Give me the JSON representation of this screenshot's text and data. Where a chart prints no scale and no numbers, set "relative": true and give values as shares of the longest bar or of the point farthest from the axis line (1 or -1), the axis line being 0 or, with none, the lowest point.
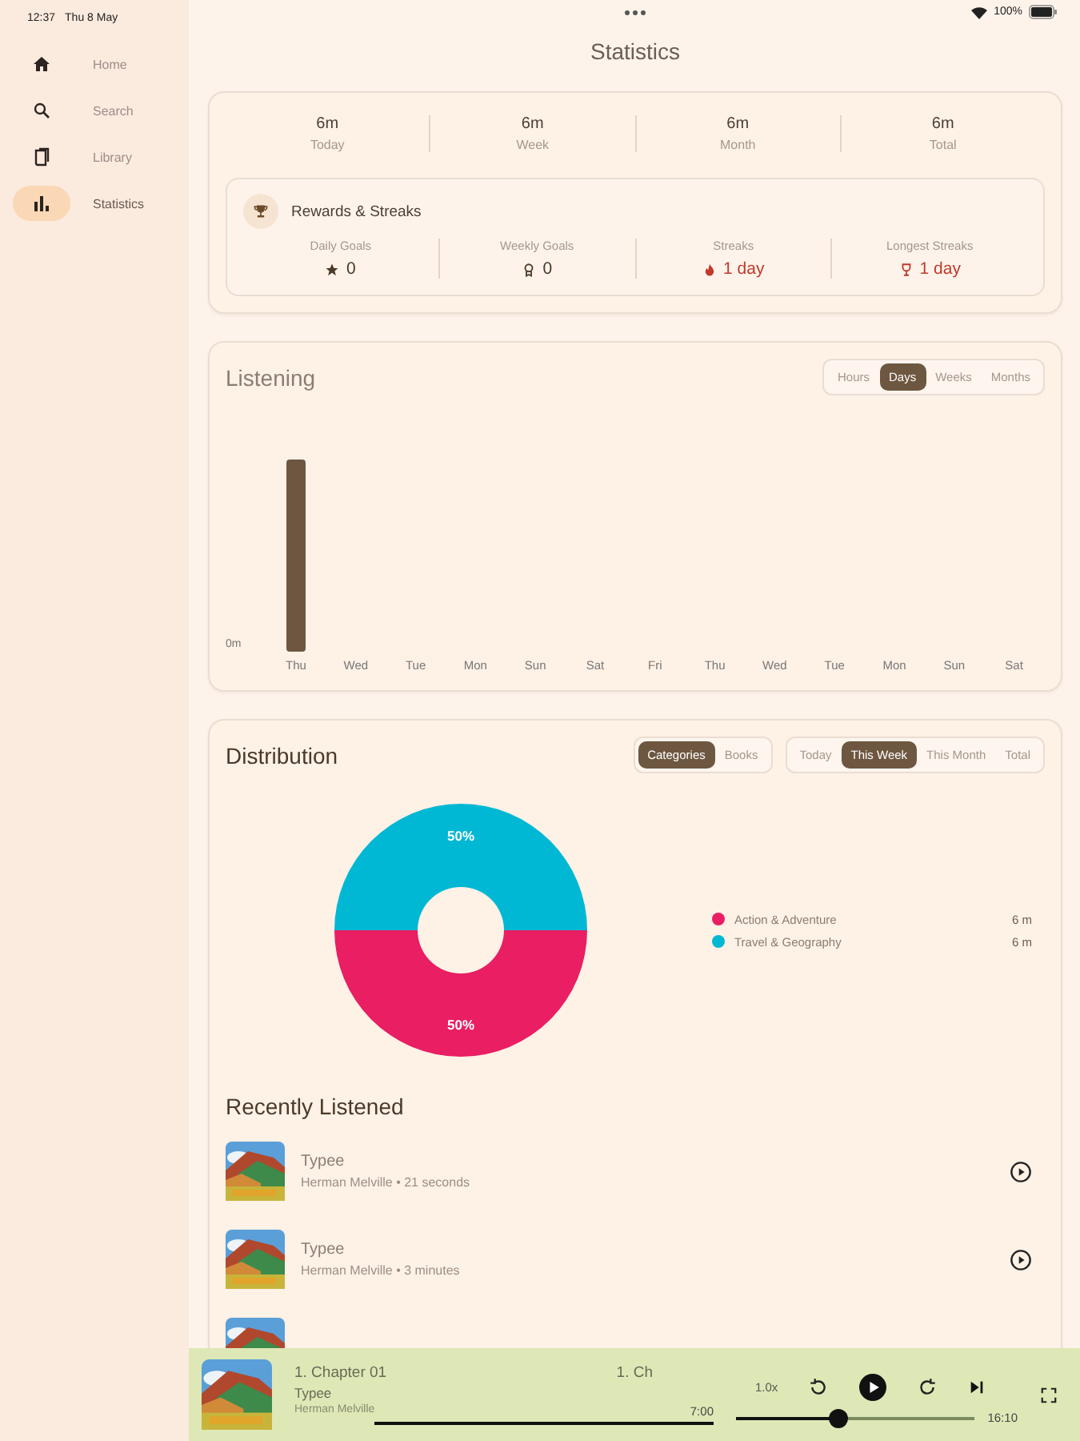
{
  "status_bar": {
    "time": "12:37",
    "date": "Thu 8 May",
    "battery": "100%"
  },
  "sidebar": {
    "items": [
      {
        "label": "Home",
        "selected": false
      },
      {
        "label": "Search",
        "selected": false
      },
      {
        "label": "Library",
        "selected": false
      },
      {
        "label": "Statistics",
        "selected": true
      }
    ]
  },
  "title": "Statistics",
  "summary": [
    {
      "value": "6m",
      "label": "Today"
    },
    {
      "value": "6m",
      "label": "Week"
    },
    {
      "value": "6m",
      "label": "Month"
    },
    {
      "value": "6m",
      "label": "Total"
    }
  ],
  "rewards": {
    "title": "Rewards & Streaks",
    "items": [
      {
        "label": "Daily Goals",
        "value": "0",
        "highlight": false
      },
      {
        "label": "Weekly Goals",
        "value": "0",
        "highlight": false
      },
      {
        "label": "Streaks",
        "value": "1 day",
        "highlight": true
      },
      {
        "label": "Longest Streaks",
        "value": "1 day",
        "highlight": true
      }
    ]
  },
  "listening": {
    "title": "Listening",
    "ranges": [
      {
        "label": "Hours",
        "selected": false
      },
      {
        "label": "Days",
        "selected": true
      },
      {
        "label": "Weeks",
        "selected": false
      },
      {
        "label": "Months",
        "selected": false
      }
    ],
    "chart_data": {
      "type": "bar",
      "categories": [
        "Thu",
        "Wed",
        "Tue",
        "Mon",
        "Sun",
        "Sat",
        "Fri",
        "Thu",
        "Wed",
        "Tue",
        "Mon",
        "Sun",
        "Sat"
      ],
      "values": [
        1,
        0,
        0,
        0,
        0,
        0,
        0,
        0,
        0,
        0,
        0,
        0,
        0
      ],
      "relative": true,
      "annotations": [
        "0m"
      ]
    }
  },
  "distribution": {
    "title": "Distribution",
    "modes": [
      {
        "label": "Categories",
        "selected": true
      },
      {
        "label": "Books",
        "selected": false
      }
    ],
    "periods": [
      {
        "label": "Today",
        "selected": false
      },
      {
        "label": "This Week",
        "selected": true
      },
      {
        "label": "This Month",
        "selected": false
      },
      {
        "label": "Total",
        "selected": false
      }
    ],
    "chart_data": {
      "type": "donut",
      "categories": [
        "Action & Adventure",
        "Travel & Geography"
      ],
      "values": [
        50,
        50
      ],
      "colors": [
        "#e91e63",
        "#00b8d4"
      ],
      "legend": "right",
      "value_labels": [
        "50%",
        "50%"
      ]
    },
    "legend_values": [
      "6 m",
      "6 m"
    ]
  },
  "recent": {
    "title": "Recently Listened",
    "items": [
      {
        "kind": "full",
        "title": "Typee",
        "subtitle": "Herman Melville • 21 seconds"
      },
      {
        "kind": "full",
        "title": "Typee",
        "subtitle": "Herman Melville • 3 minutes"
      },
      {
        "kind": "cover-only"
      }
    ]
  },
  "player": {
    "chapter": "1. Chapter 01",
    "next_chapter": "1. Ch",
    "title": "Typee",
    "author": "Herman Melville",
    "speed": "1.0x",
    "position": "7:00",
    "duration": "16:10",
    "seek": {
      "level": 0.43
    }
  }
}
